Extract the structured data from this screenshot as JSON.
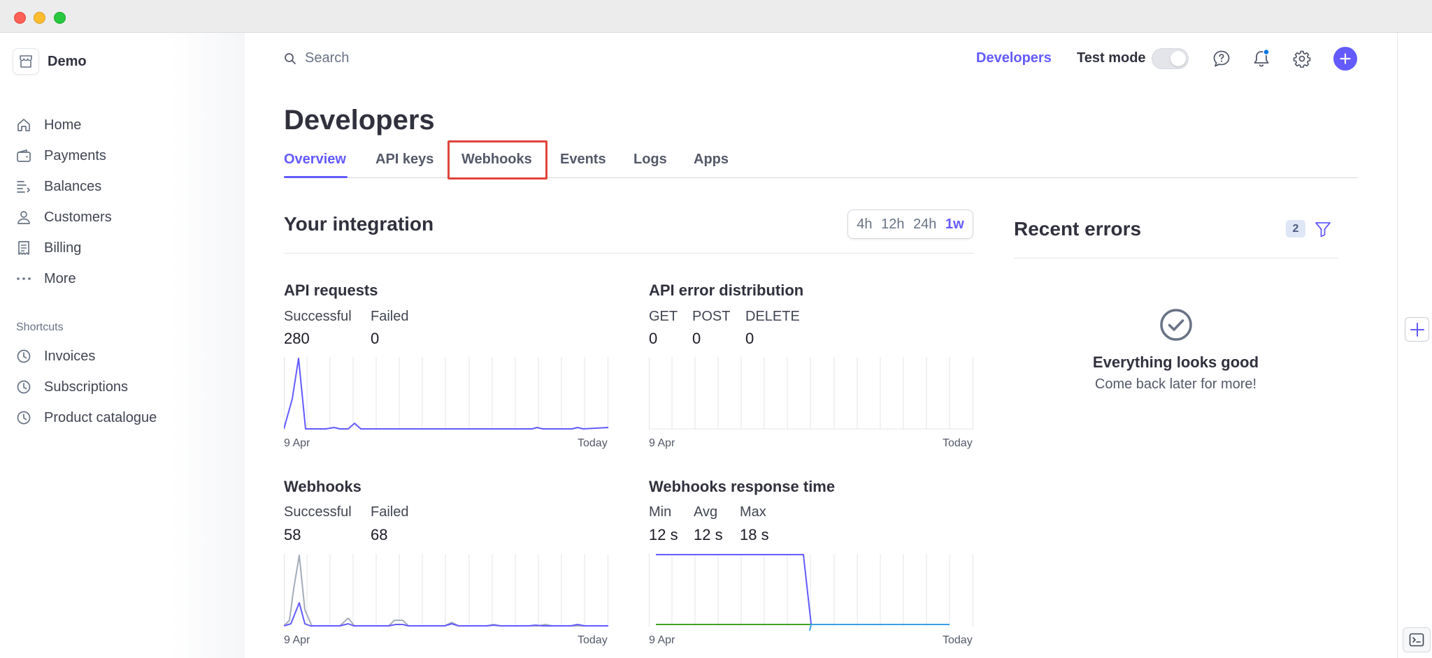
{
  "sidebar": {
    "brand": "Demo",
    "items": [
      {
        "label": "Home",
        "icon": "home-icon"
      },
      {
        "label": "Payments",
        "icon": "wallet-icon"
      },
      {
        "label": "Balances",
        "icon": "balances-icon"
      },
      {
        "label": "Customers",
        "icon": "person-icon"
      },
      {
        "label": "Billing",
        "icon": "receipt-icon"
      },
      {
        "label": "More",
        "icon": "ellipsis-icon"
      }
    ],
    "shortcuts_heading": "Shortcuts",
    "shortcuts": [
      {
        "label": "Invoices",
        "icon": "clock-icon"
      },
      {
        "label": "Subscriptions",
        "icon": "clock-icon"
      },
      {
        "label": "Product catalogue",
        "icon": "clock-icon"
      }
    ]
  },
  "topbar": {
    "search_label": "Search",
    "developers_link": "Developers",
    "test_mode_label": "Test mode",
    "test_mode_on": false
  },
  "page": {
    "title": "Developers",
    "tabs": [
      "Overview",
      "API keys",
      "Webhooks",
      "Events",
      "Logs",
      "Apps"
    ],
    "active_tab": "Overview",
    "highlighted_tab": "Webhooks"
  },
  "integration": {
    "title": "Your integration",
    "ranges": [
      "4h",
      "12h",
      "24h",
      "1w"
    ],
    "selected_range": "1w"
  },
  "metrics": {
    "api_requests": {
      "title": "API requests",
      "labels": [
        "Successful",
        "Failed"
      ],
      "values": [
        "280",
        "0"
      ],
      "axis_start": "9 Apr",
      "axis_end": "Today"
    },
    "api_errors": {
      "title": "API error distribution",
      "labels": [
        "GET",
        "POST",
        "DELETE"
      ],
      "values": [
        "0",
        "0",
        "0"
      ],
      "axis_start": "9 Apr",
      "axis_end": "Today"
    },
    "webhooks": {
      "title": "Webhooks",
      "labels": [
        "Successful",
        "Failed"
      ],
      "values": [
        "58",
        "68"
      ],
      "axis_start": "9 Apr",
      "axis_end": "Today"
    },
    "webhook_response": {
      "title": "Webhooks response time",
      "labels": [
        "Min",
        "Avg",
        "Max"
      ],
      "values": [
        "12 s",
        "12 s",
        "18 s"
      ],
      "axis_start": "9 Apr",
      "axis_end": "Today"
    }
  },
  "recent_errors": {
    "title": "Recent errors",
    "count": "2",
    "empty_title": "Everything looks good",
    "empty_subtitle": "Come back later for more!"
  },
  "colors": {
    "accent": "#635bff",
    "failed_series": "#a3acb9",
    "green_series": "#3fa329",
    "blue_series": "#3aa0e8"
  }
}
